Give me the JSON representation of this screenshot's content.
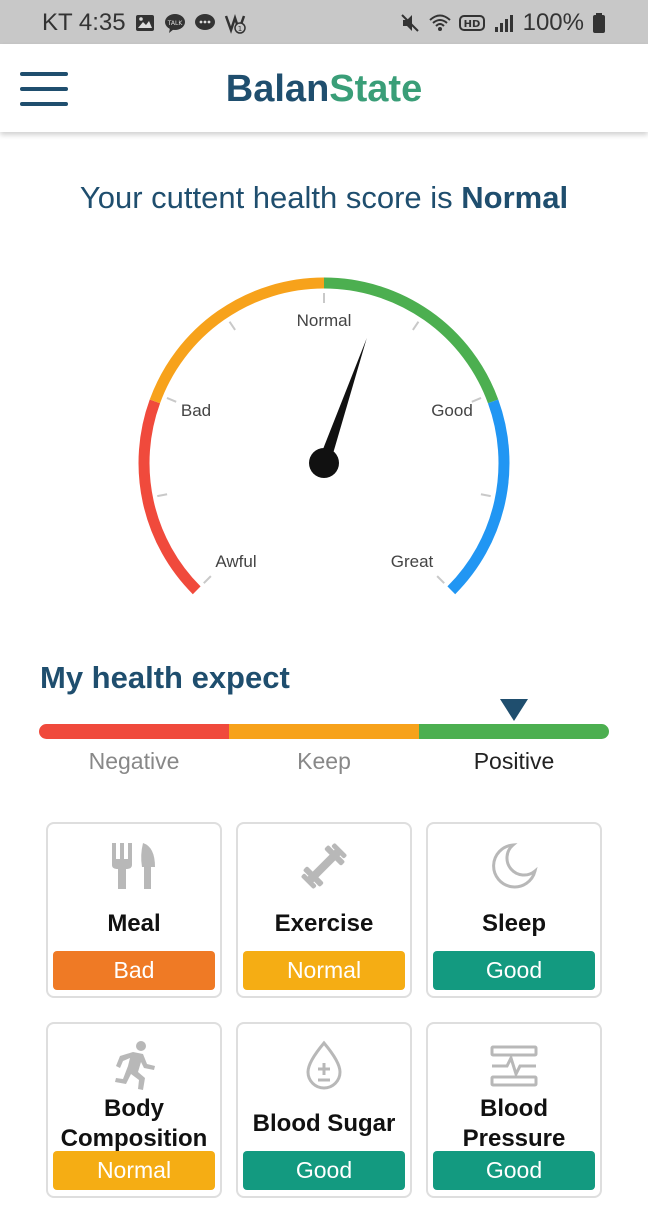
{
  "status_bar": {
    "carrier_time": "KT 4:35",
    "battery": "100%",
    "left_icons": [
      "gallery-icon",
      "kakaotalk-icon",
      "messenger-icon",
      "notification-icon"
    ],
    "right_icons": [
      "mute-icon",
      "wifi-icon",
      "hd-icon",
      "signal-icon",
      "battery-icon"
    ]
  },
  "app": {
    "brand_part1": "Balan",
    "brand_part2": "State",
    "brand_colors": {
      "part1": "#1f4e6e",
      "part2": "#3a9e78"
    }
  },
  "score": {
    "prefix": "Your cuttent health score is ",
    "value": "Normal"
  },
  "gauge": {
    "labels": [
      "Awful",
      "Bad",
      "Normal",
      "Good",
      "Great"
    ],
    "segment_colors": [
      "#f04a3c",
      "#f7a21b",
      "#4caf50",
      "#2196f3"
    ],
    "needle_level": 0.57
  },
  "expect": {
    "title": "My health expect",
    "labels": [
      "Negative",
      "Keep",
      "Positive"
    ],
    "active": "Positive",
    "bar_colors": [
      "#f04a3c",
      "#f7a21b",
      "#4caf50"
    ]
  },
  "categories": [
    {
      "name": "Meal",
      "status": "Bad",
      "color": "#ef7a25",
      "icon": "utensils-icon"
    },
    {
      "name": "Exercise",
      "status": "Normal",
      "color": "#f5ad14",
      "icon": "dumbbell-icon"
    },
    {
      "name": "Sleep",
      "status": "Good",
      "color": "#139a80",
      "icon": "moon-icon"
    },
    {
      "name_line1": "Body",
      "name_line2": "Composition",
      "status": "Normal",
      "color": "#f5ad14",
      "icon": "running-icon"
    },
    {
      "name": "Blood Sugar",
      "status": "Good",
      "color": "#139a80",
      "icon": "blood-drop-icon"
    },
    {
      "name_line1": "Blood",
      "name_line2": "Pressure",
      "status": "Good",
      "color": "#139a80",
      "icon": "pulse-monitor-icon"
    }
  ]
}
